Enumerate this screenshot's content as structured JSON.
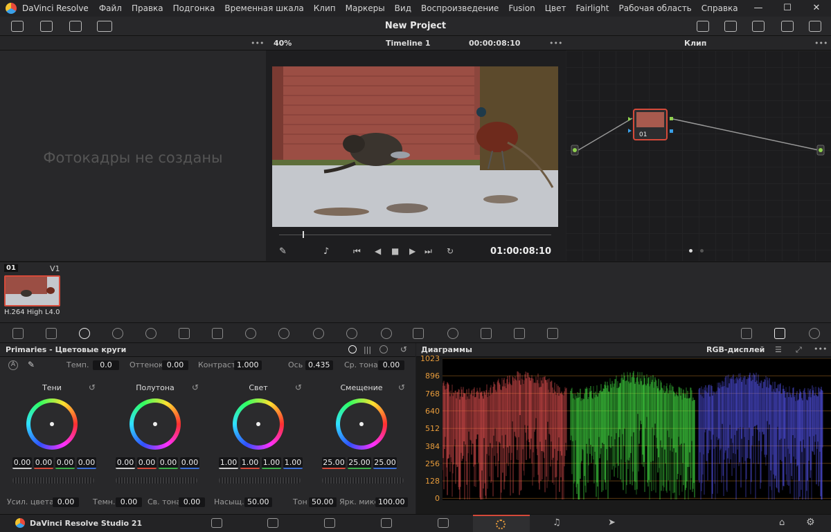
{
  "app": {
    "title": "DaVinci Resolve",
    "menu": [
      "Файл",
      "Правка",
      "Подгонка",
      "Временная шкала",
      "Клип",
      "Маркеры",
      "Вид",
      "Воспроизведение",
      "Fusion",
      "Цвет",
      "Fairlight",
      "Рабочая область",
      "Справка"
    ],
    "window_buttons": [
      "—",
      "☐",
      "✕"
    ]
  },
  "project": {
    "title": "New Project"
  },
  "viewer": {
    "zoom": "40%",
    "timeline_name": "Timeline 1",
    "timecode_top": "00:00:08:10",
    "timecode_bottom": "01:00:08:10"
  },
  "nodes": {
    "mode": "Клип",
    "node_label": "01"
  },
  "gallery": {
    "empty_message": "Фотокадры не созданы"
  },
  "timeline": {
    "clip_number": "01",
    "track": "V1",
    "codec": "H.264 High L4.0"
  },
  "primaries": {
    "title": "Primaries - Цветовые круги",
    "top_fields": [
      {
        "label": "Темп.",
        "value": "0.0"
      },
      {
        "label": "Оттенок",
        "value": "0.00"
      },
      {
        "label": "Контраст",
        "value": "1.000"
      },
      {
        "label": "Ось",
        "value": "0.435"
      },
      {
        "label": "Ср. тона",
        "value": "0.00"
      }
    ],
    "wheels": [
      {
        "name": "Тени",
        "values": [
          "0.00",
          "0.00",
          "0.00",
          "0.00"
        ]
      },
      {
        "name": "Полутона",
        "values": [
          "0.00",
          "0.00",
          "0.00",
          "0.00"
        ]
      },
      {
        "name": "Свет",
        "values": [
          "1.00",
          "1.00",
          "1.00",
          "1.00"
        ]
      },
      {
        "name": "Смещение",
        "values": [
          "25.00",
          "25.00",
          "25.00"
        ]
      }
    ],
    "bottom_fields": [
      {
        "label": "Усил. цвета",
        "value": "0.00"
      },
      {
        "label": "Темн.",
        "value": "0.00"
      },
      {
        "label": "Св. тона",
        "value": "0.00"
      },
      {
        "label": "Насыщ.",
        "value": "50.00"
      },
      {
        "label": "Тон",
        "value": "50.00"
      },
      {
        "label": "Ярк. микс",
        "value": "100.00"
      }
    ]
  },
  "scopes": {
    "title": "Диаграммы",
    "mode": "RGB-дисплей",
    "y_ticks": [
      "1023",
      "896",
      "768",
      "640",
      "512",
      "384",
      "256",
      "128",
      "0"
    ]
  },
  "footer": {
    "brand": "DaVinci Resolve Studio 21"
  },
  "colors": {
    "accent_red": "#d64a3a",
    "scope_tick": "#e89c3b"
  }
}
